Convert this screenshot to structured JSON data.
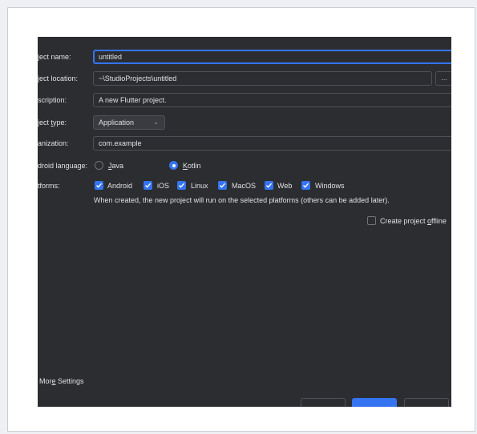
{
  "form": {
    "project_name": {
      "label": "ject name:",
      "value": "untitled"
    },
    "project_location": {
      "label": "ject location:",
      "value": "~\\StudioProjects\\untitled",
      "browse_label": "..."
    },
    "description": {
      "label": "scription:",
      "value": "A new Flutter project."
    },
    "project_type": {
      "label": "ject type:",
      "value": "Application"
    },
    "organization": {
      "label": "anization:",
      "value": "com.example"
    },
    "android_language": {
      "label": "droid language:",
      "options": [
        {
          "label": "Java",
          "selected": false
        },
        {
          "label": "Kotlin",
          "selected": true
        }
      ]
    },
    "platforms": {
      "label": "tforms:",
      "items": [
        {
          "label": "Android",
          "checked": true
        },
        {
          "label": "iOS",
          "checked": true
        },
        {
          "label": "Linux",
          "checked": true
        },
        {
          "label": "MacOS",
          "checked": true
        },
        {
          "label": "Web",
          "checked": true
        },
        {
          "label": "Windows",
          "checked": true
        }
      ],
      "note": "When created, the new project will run on the selected platforms (others can be added later)."
    },
    "offline": {
      "label": "Create project offline",
      "checked": false
    }
  },
  "footer": {
    "more_settings": "More Settings"
  },
  "colors": {
    "accent": "#3574f0",
    "dialog_bg": "#2b2d30",
    "text": "#dfe1e5",
    "border": "#4e5157"
  }
}
